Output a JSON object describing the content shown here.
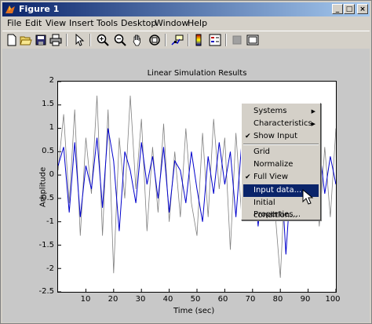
{
  "window": {
    "title": "Figure 1"
  },
  "titlebar_buttons": {
    "minimize": "_",
    "maximize": "□",
    "close": "×"
  },
  "menu": [
    "File",
    "Edit",
    "View",
    "Insert",
    "Tools",
    "Desktop",
    "Window",
    "Help"
  ],
  "toolbar": {
    "icons": [
      "new-file-icon",
      "open-file-icon",
      "save-icon",
      "print-icon",
      "pointer-icon",
      "zoom-in-icon",
      "zoom-out-icon",
      "pan-icon",
      "rotate-3d-icon",
      "data-cursor-icon",
      "colorbar-icon",
      "legend-icon",
      "hide-plot-tools-icon",
      "show-plot-tools-icon"
    ]
  },
  "plot": {
    "title": "Linear Simulation Results",
    "xlabel": "Time (sec)",
    "ylabel": "Amplitude",
    "yticks": [
      "2",
      "1.5",
      "1",
      "0.5",
      "0",
      "-0.5",
      "-1",
      "-1.5",
      "-2",
      "-2.5"
    ],
    "xticks": [
      "10",
      "20",
      "30",
      "40",
      "50",
      "60",
      "70",
      "80",
      "90",
      "100"
    ]
  },
  "context_menu": {
    "items": [
      {
        "label": "Systems",
        "submenu": true,
        "checked": false
      },
      {
        "label": "Characteristics",
        "submenu": true,
        "checked": false
      },
      {
        "label": "Show Input",
        "submenu": false,
        "checked": true
      },
      {
        "label": "Grid",
        "submenu": false,
        "checked": false
      },
      {
        "label": "Normalize",
        "submenu": false,
        "checked": false
      },
      {
        "label": "Full View",
        "submenu": false,
        "checked": true
      },
      {
        "label": "Input data...",
        "submenu": false,
        "checked": false,
        "selected": true
      },
      {
        "label": "Initial condition...",
        "submenu": false,
        "checked": false
      },
      {
        "label": "Properties...",
        "submenu": false,
        "checked": false
      }
    ]
  },
  "chart_data": {
    "type": "line",
    "xlim": [
      0,
      100
    ],
    "ylim": [
      -2.5,
      2
    ],
    "grid": false,
    "series": [
      {
        "color": "#808080",
        "x": [
          0,
          2,
          4,
          6,
          8,
          10,
          12,
          14,
          16,
          18,
          20,
          22,
          24,
          26,
          28,
          30,
          32,
          34,
          36,
          38,
          40,
          42,
          44,
          46,
          48,
          50,
          52,
          54,
          56,
          58,
          60,
          62,
          64,
          66,
          68,
          70,
          72,
          74,
          76,
          78,
          80,
          82,
          84,
          86,
          88,
          90,
          92,
          94,
          96,
          98,
          100
        ],
        "values": [
          0.1,
          1.3,
          -0.6,
          1.4,
          -1.3,
          0.8,
          -0.4,
          1.7,
          -1.3,
          1.4,
          -2.1,
          0.8,
          -0.5,
          1.7,
          -0.3,
          1.2,
          -1.2,
          0.6,
          -0.8,
          1.1,
          -1.0,
          0.5,
          -0.9,
          1.0,
          -0.6,
          -1.3,
          0.9,
          -0.9,
          1.2,
          -0.3,
          0.8,
          -1.6,
          0.9,
          -0.8,
          1.1,
          -0.9,
          1.3,
          -0.4,
          1.1,
          -0.7,
          -2.2,
          0.3,
          1.5,
          -0.6,
          0.8,
          -0.9,
          1.2,
          -1.1,
          0.6,
          -0.9,
          1.0
        ]
      },
      {
        "color": "#0000cc",
        "x": [
          0,
          2,
          4,
          6,
          8,
          10,
          12,
          14,
          16,
          18,
          20,
          22,
          24,
          26,
          28,
          30,
          32,
          34,
          36,
          38,
          40,
          42,
          44,
          46,
          48,
          50,
          52,
          54,
          56,
          58,
          60,
          62,
          64,
          66,
          68,
          70,
          72,
          74,
          76,
          78,
          80,
          82,
          84,
          86,
          88,
          90,
          92,
          94,
          96,
          98,
          100
        ],
        "values": [
          0.2,
          0.6,
          -0.8,
          0.7,
          -0.9,
          0.2,
          -0.3,
          0.8,
          -0.7,
          1.0,
          0.3,
          -1.2,
          0.5,
          0.1,
          -0.6,
          0.7,
          -0.2,
          0.4,
          -0.5,
          0.6,
          -0.8,
          0.3,
          0.1,
          -0.6,
          0.5,
          -0.3,
          -1.0,
          0.4,
          -0.4,
          0.7,
          -0.2,
          0.5,
          -0.9,
          0.6,
          -0.4,
          0.3,
          -1.1,
          0.2,
          0.6,
          -0.5,
          0.4,
          -1.7,
          0.1,
          0.8,
          -0.3,
          0.5,
          -0.7,
          0.6,
          -0.4,
          0.4,
          -0.2
        ]
      }
    ]
  }
}
